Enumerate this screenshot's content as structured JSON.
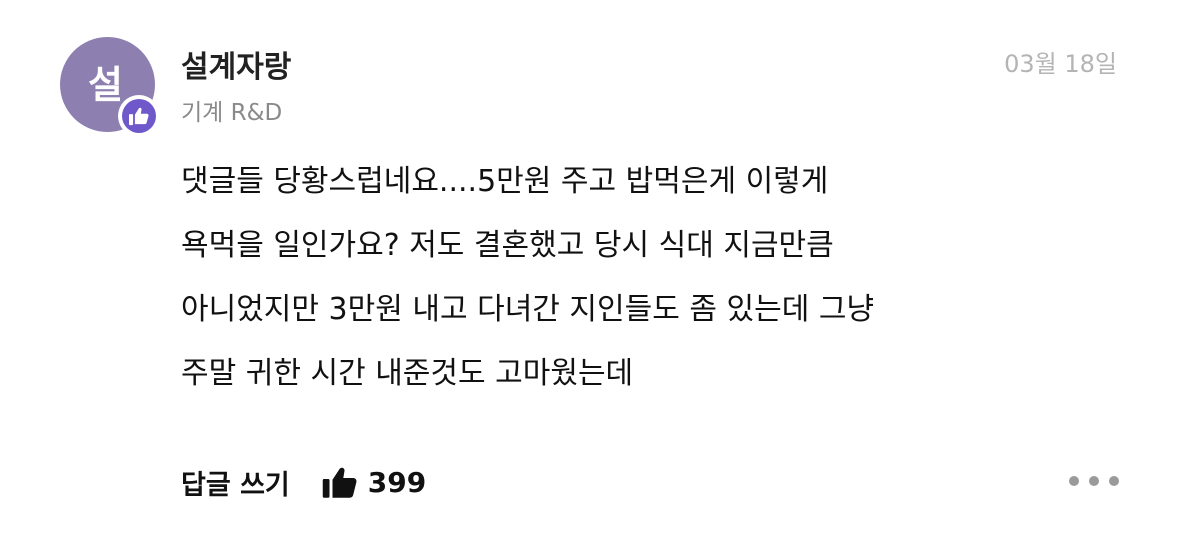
{
  "comment": {
    "avatar_initial": "설",
    "author_name": "설계자랑",
    "author_department": "기계 R&D",
    "date": "03월 18일",
    "body_lines": [
      "댓글들 당황스럽네요....5만원 주고 밥먹은게 이렇게",
      "욕먹을 일인가요? 저도 결혼했고 당시 식대 지금만큼",
      "아니었지만 3만원 내고 다녀간 지인들도 좀 있는데 그냥",
      "주말 귀한 시간 내준것도 고마웠는데"
    ],
    "reply_label": "답글 쓰기",
    "like_count": "399",
    "like_icon": "thumbs-up-icon",
    "badge_icon": "thumbs-up-badge-icon",
    "more_icon": "more-horizontal-icon",
    "colors": {
      "avatar_bg": "#8d7fb0",
      "badge_bg": "#6f58c9",
      "date_text": "#b4b4b4",
      "dept_text": "#8a8a8a"
    }
  }
}
